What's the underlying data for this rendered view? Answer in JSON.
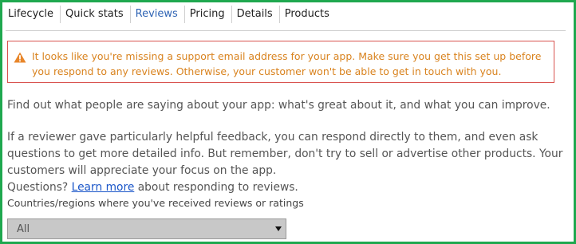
{
  "tabs": [
    {
      "label": "Lifecycle"
    },
    {
      "label": "Quick stats"
    },
    {
      "label": "Reviews"
    },
    {
      "label": "Pricing"
    },
    {
      "label": "Details"
    },
    {
      "label": "Products"
    }
  ],
  "active_tab": "Reviews",
  "alert": {
    "icon": "warning-icon",
    "text": "It looks like you're missing a support email address for your app. Make sure you get this set up before you respond to any reviews. Otherwise, your customer won't be able to get in touch with you."
  },
  "intro": "Find out what people are saying about your app: what's great about it, and what you can improve.",
  "feedback": "If a reviewer gave particularly helpful feedback, you can respond directly to them, and even ask questions to get more detailed info. But remember, don't try to sell or advertise other products. Your customers will appreciate your focus on the app.",
  "questions": {
    "prefix": "Questions?",
    "link": "Learn more",
    "suffix": "about responding to reviews."
  },
  "countries_label": "Countries/regions where you've received reviews or ratings",
  "countries_select": {
    "value": "All"
  },
  "colors": {
    "frame_border": "#1fa84f",
    "active_tab": "#2f64b4",
    "alert_border": "#d9534f",
    "alert_text": "#d9831f",
    "link": "#1a56c9"
  }
}
